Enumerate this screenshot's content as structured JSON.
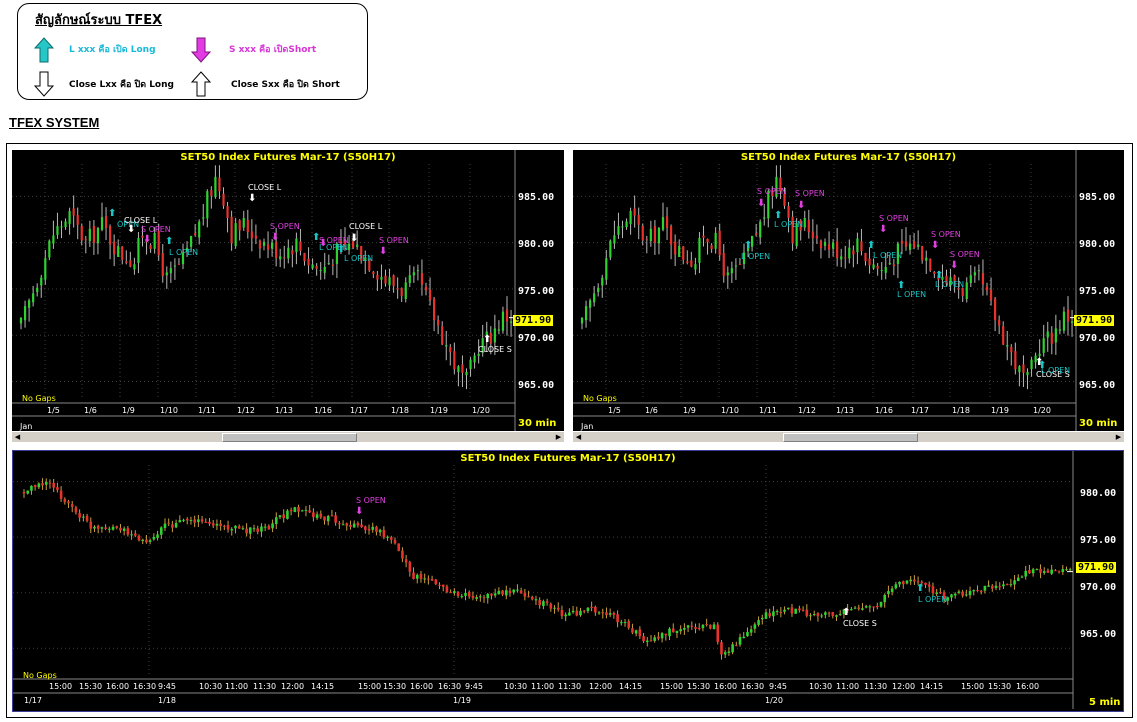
{
  "legend": {
    "title": "สัญลักษณ์ระบบ TFEX",
    "open_long": "L xxx คือ เปิด Long",
    "open_short": "S xxx คือ เปิดShort",
    "close_long": "Close Lxx คือ ปิด Long",
    "close_short": "Close Sxx คือ ปิด Short"
  },
  "system_title": "TFEX SYSTEM",
  "colors": {
    "bull": "#2fd32f",
    "bear": "#e8332d",
    "long_signal": "#19c6c6",
    "short_signal": "#e040e0",
    "close_signal": "#ffffff",
    "title": "#ffff00"
  },
  "top_left": {
    "title": "SET50  Index  Futures  Mar-17  (S50H17)",
    "no_gaps": "No Gaps",
    "yticks": [
      "985.00",
      "980.00",
      "975.00",
      "970.00",
      "965.00"
    ],
    "current": "971.90",
    "interval": "30  min",
    "month": "Jan",
    "dates": [
      "1/5",
      "1/6",
      "1/9",
      "1/10",
      "1/11",
      "1/12",
      "1/13",
      "1/16",
      "1/17",
      "1/18",
      "1/19",
      "1/20"
    ],
    "signals": [
      "OPEN",
      "CLOSE L",
      "S  OPEN",
      "L  OPEN",
      "CLOSE  L",
      "S  OPEN",
      "L  OPEN",
      "S  OPEN",
      "CLOSE  L",
      "S  OPEN",
      "L  OPEN",
      "CLOSE  S"
    ]
  },
  "top_right": {
    "title": "SET50  Index  Futures  Mar-17  (S50H17)",
    "no_gaps": "No Gaps",
    "yticks": [
      "985.00",
      "980.00",
      "975.00",
      "970.00",
      "965.00"
    ],
    "current": "971.90",
    "interval": "30  min",
    "month": "Jan",
    "dates": [
      "1/5",
      "1/6",
      "1/9",
      "1/10",
      "1/11",
      "1/12",
      "1/13",
      "1/16",
      "1/17",
      "1/18",
      "1/19",
      "1/20"
    ],
    "signals": [
      "S  OPEN",
      "S  OPEN",
      "L  OPEN",
      "L  OPEN",
      "S  OPEN",
      "L  OPEN",
      "L  OPEN",
      "S  OPEN",
      "S  OPEN",
      "L  OPEN",
      "CLOSE  S",
      "L  OPEN"
    ]
  },
  "bottom": {
    "title": "SET50  Index  Futures  Mar-17  (S50H17)",
    "no_gaps": "No Gaps",
    "yticks": [
      "980.00",
      "975.00",
      "970.00",
      "965.00"
    ],
    "current": "971.90",
    "interval": "5  min",
    "times": [
      "15:00",
      "15:30",
      "16:00",
      "16:30",
      "9:45",
      "10:30",
      "11:00",
      "11:30",
      "12:00",
      "14:15",
      "15:00",
      "15:30",
      "16:00",
      "16:30",
      "9:45",
      "10:30",
      "11:00",
      "11:30",
      "12:00",
      "14:15",
      "15:00",
      "15:30",
      "16:00",
      "16:30",
      "9:45",
      "10:30",
      "11:00",
      "11:30",
      "12:00",
      "14:15",
      "15:00",
      "15:30",
      "16:00"
    ],
    "days": [
      "1/17",
      "1/18",
      "1/19",
      "1/20"
    ],
    "signals": [
      "S  OPEN",
      "CLOSE  S",
      "L  OPEN"
    ]
  },
  "chart_data": [
    {
      "type": "candlestick",
      "title": "SET50  Index  Futures  Mar-17  (S50H17)",
      "interval": "30 min",
      "ylim": [
        963,
        989
      ],
      "x": [
        "1/5",
        "1/6",
        "1/9",
        "1/10",
        "1/11",
        "1/12",
        "1/13",
        "1/16",
        "1/17",
        "1/18",
        "1/19",
        "1/20"
      ],
      "close": [
        982,
        983,
        979,
        981,
        987,
        981,
        980,
        979,
        980,
        975,
        967,
        971.9
      ],
      "last": 971.9
    },
    {
      "type": "candlestick",
      "title": "SET50  Index  Futures  Mar-17  (S50H17)",
      "interval": "30 min",
      "ylim": [
        963,
        989
      ],
      "x": [
        "1/5",
        "1/6",
        "1/9",
        "1/10",
        "1/11",
        "1/12",
        "1/13",
        "1/16",
        "1/17",
        "1/18",
        "1/19",
        "1/20"
      ],
      "close": [
        982,
        983,
        979,
        981,
        987,
        981,
        980,
        979,
        980,
        975,
        967,
        971.9
      ],
      "last": 971.9
    },
    {
      "type": "candlestick",
      "title": "SET50  Index  Futures  Mar-17  (S50H17)",
      "interval": "5 min",
      "ylim": [
        962,
        982
      ],
      "x": [
        "1/17",
        "1/18",
        "1/19",
        "1/20"
      ],
      "close": [
        977,
        976,
        966,
        971.9
      ],
      "last": 971.9
    }
  ]
}
